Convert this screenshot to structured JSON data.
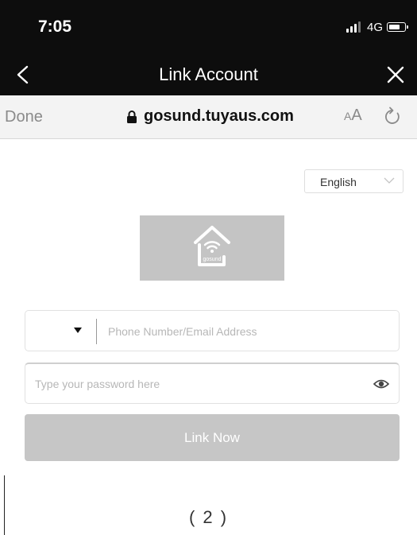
{
  "status_bar": {
    "time": "7:05",
    "network": "4G"
  },
  "nav": {
    "title": "Link Account"
  },
  "browser": {
    "done_label": "Done",
    "url": "gosund.tuyaus.com",
    "text_size_small": "A",
    "text_size_large": "A"
  },
  "language_select": {
    "selected": "English"
  },
  "logo": {
    "brand_text": "gosund"
  },
  "phone_field": {
    "placeholder": "Phone Number/Email Address"
  },
  "password_field": {
    "placeholder": "Type your password here"
  },
  "link_button": {
    "label": "Link Now"
  },
  "caption": {
    "text": "( 2 )"
  },
  "colors": {
    "bar_bg": "#0d0d0d",
    "button_disabled": "#c6c6c6",
    "logo_bg": "#c4c4c4"
  }
}
